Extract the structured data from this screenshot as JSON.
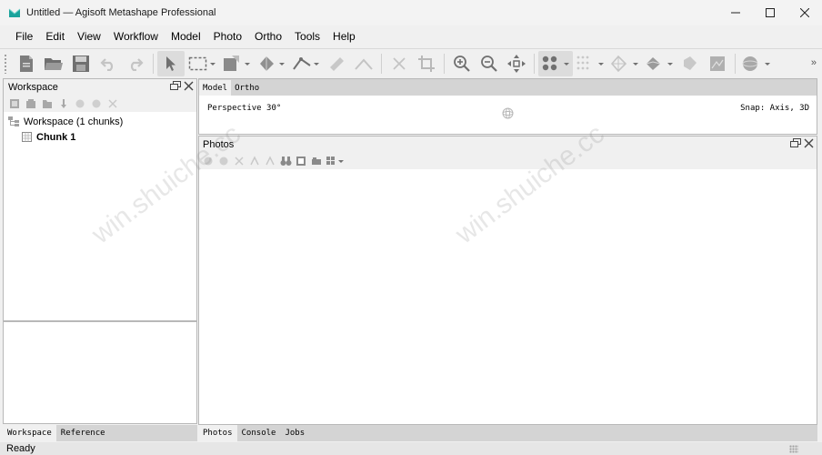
{
  "window": {
    "title": "Untitled — Agisoft Metashape Professional",
    "accent_color": "#1ba39c"
  },
  "menu": {
    "items": [
      "File",
      "Edit",
      "View",
      "Workflow",
      "Model",
      "Photo",
      "Ortho",
      "Tools",
      "Help"
    ]
  },
  "toolbar": {
    "more_label": "»",
    "icons": [
      "new-icon",
      "open-icon",
      "save-icon",
      "undo-icon",
      "redo-icon",
      "navigation-icon",
      "rectangle-selection-icon",
      "shape-draw-icon",
      "transform-icon",
      "ruler-polyline-icon",
      "ruler-icon",
      "draw-polyline-icon",
      "delete-selection-icon",
      "crop-selection-icon",
      "zoom-in-icon",
      "zoom-out-icon",
      "move-region-icon",
      "show-points-icon",
      "show-cameras-icon",
      "show-shapes-icon",
      "show-model-icon",
      "show-markers-icon",
      "show-ortho-icon",
      "show-trackball-icon"
    ]
  },
  "workspace": {
    "title": "Workspace",
    "tree": {
      "root_label": "Workspace (1 chunks)",
      "chunks": [
        "Chunk 1"
      ]
    },
    "tabs": [
      "Workspace",
      "Reference"
    ],
    "active_tab": "Workspace"
  },
  "model_view": {
    "tabs": [
      "Model",
      "Ortho"
    ],
    "active_tab": "Model",
    "projection_label": "Perspective 30°",
    "snap_label": "Snap: Axis, 3D"
  },
  "photos": {
    "title": "Photos"
  },
  "bottom_tabs": {
    "items": [
      "Photos",
      "Console",
      "Jobs"
    ],
    "active": "Photos"
  },
  "status": {
    "text": "Ready"
  },
  "watermark": {
    "text": "win.shuiche.cc"
  }
}
